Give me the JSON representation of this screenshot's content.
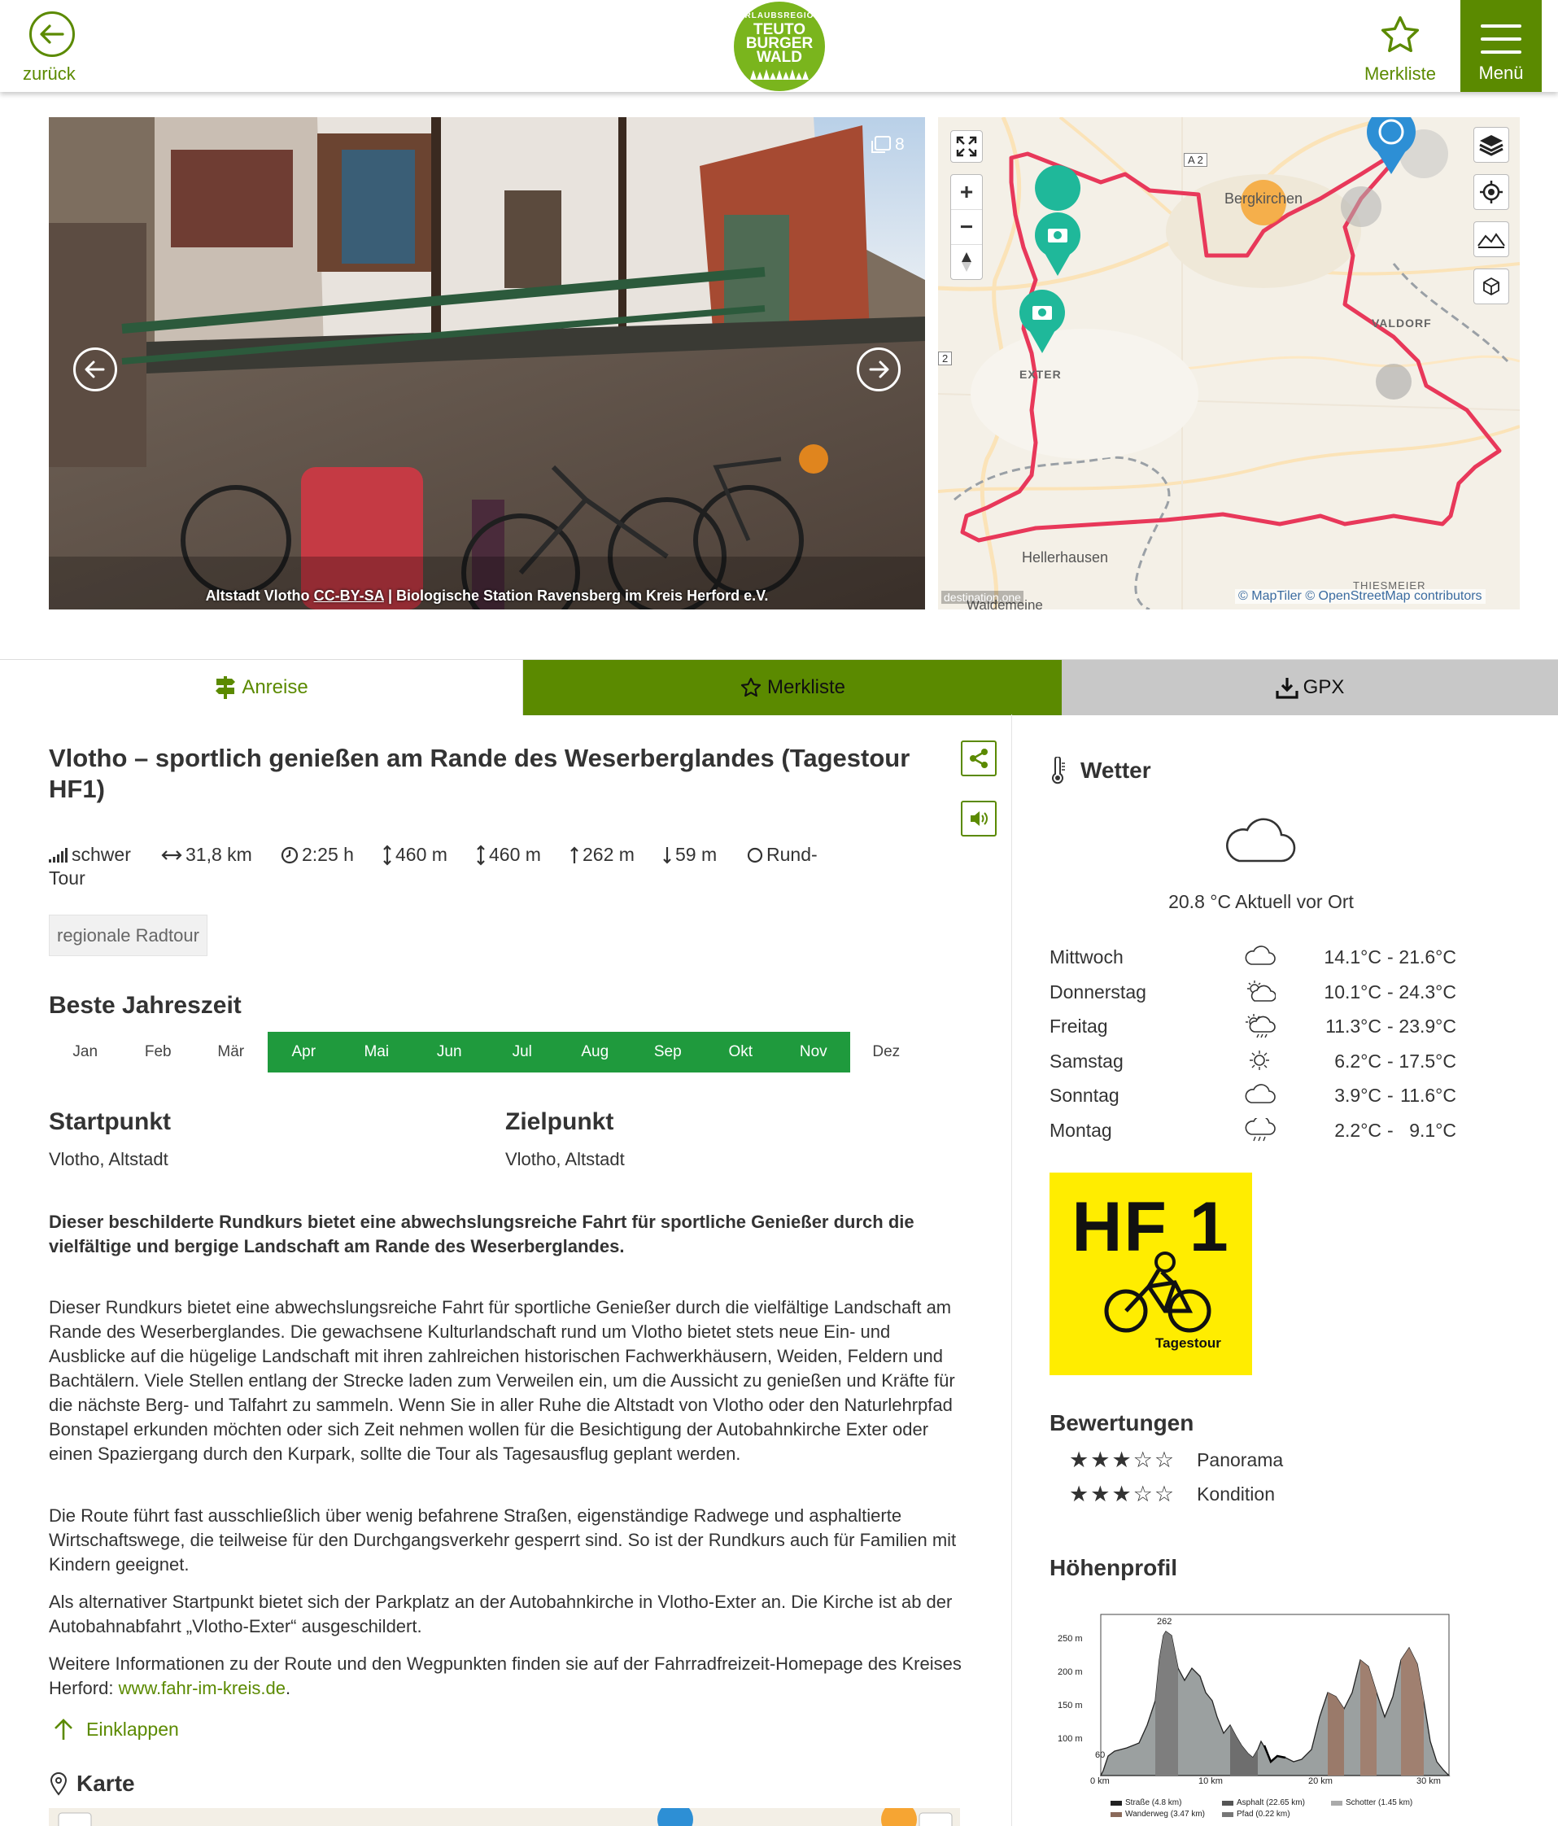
{
  "header": {
    "back_label": "zurück",
    "logo": {
      "line1": "URLAUBSREGION",
      "line2": "TEUTO",
      "line3": "BURGER",
      "line4": "WALD"
    },
    "favorites_label": "Merkliste",
    "menu_label": "Menü"
  },
  "gallery": {
    "image_count": "8",
    "caption_title": "Altstadt Vlotho",
    "caption_license": "CC-BY-SA",
    "caption_author": "| Biologische Station Ravensberg im Kreis Herford e.V."
  },
  "map": {
    "labels": {
      "a2_top": "A 2",
      "a2_left": "2",
      "bergkirchen": "Bergkirchen",
      "valdorf": "VALDORF",
      "exter": "EXTER",
      "hellerhausen": "Hellerhausen",
      "thiesmeier": "THIESMEIER",
      "waldemeine": "Waldemeine",
      "brand": "destination.one"
    },
    "attribution": "© MapTiler © OpenStreetMap contributors",
    "zoom_in": "+",
    "zoom_out": "−"
  },
  "tabs": {
    "travel": "Anreise",
    "favorites": "Merkliste",
    "gpx": "GPX"
  },
  "tour": {
    "title": "Vlotho – sportlich genießen am Rande des Weserberglandes (Tagestour HF1)",
    "stats": {
      "difficulty": "schwer",
      "distance": "31,8 km",
      "duration": "2:25 h",
      "ascent": "460 m",
      "descent": "460 m",
      "max_alt": "262 m",
      "min_alt": "59 m",
      "type_line1": "Rund-",
      "type_line2": "Tour"
    },
    "tag": "regionale Radtour",
    "best_season_title": "Beste Jahreszeit",
    "months": [
      {
        "label": "Jan",
        "active": false
      },
      {
        "label": "Feb",
        "active": false
      },
      {
        "label": "Mär",
        "active": false
      },
      {
        "label": "Apr",
        "active": true
      },
      {
        "label": "Mai",
        "active": true
      },
      {
        "label": "Jun",
        "active": true
      },
      {
        "label": "Jul",
        "active": true
      },
      {
        "label": "Aug",
        "active": true
      },
      {
        "label": "Sep",
        "active": true
      },
      {
        "label": "Okt",
        "active": true
      },
      {
        "label": "Nov",
        "active": true
      },
      {
        "label": "Dez",
        "active": false
      }
    ],
    "start_title": "Startpunkt",
    "start_value": "Vlotho, Altstadt",
    "end_title": "Zielpunkt",
    "end_value": "Vlotho, Altstadt",
    "lead": "Dieser beschilderte Rundkurs bietet eine abwechslungsreiche Fahrt für sportliche Genießer durch die vielfältige und bergige Landschaft am Rande des Weserberglandes.",
    "para1": "Dieser Rundkurs bietet eine abwechslungsreiche Fahrt für sportliche Genießer durch die vielfältige Landschaft am Rande des Weserberglandes. Die gewachsene Kulturlandschaft rund um Vlotho bietet stets neue Ein- und Ausblicke auf die hügelige Landschaft mit ihren zahlreichen historischen Fachwerkhäusern, Weiden, Feldern und Bachtälern. Viele Stellen entlang der Strecke laden zum Verweilen ein, um die Aussicht zu genießen und Kräfte für die nächste Berg- und Talfahrt zu sammeln. Wenn Sie in aller Ruhe die Altstadt von Vlotho oder den Naturlehrpfad Bonstapel erkunden möchten oder sich Zeit nehmen wollen für die Besichtigung der Autobahnkirche Exter oder einen Spaziergang durch den Kurpark, sollte die Tour als Tagesausflug geplant werden.",
    "para2": "Die Route führt fast ausschließlich über wenig befahrene Straßen, eigenständige Radwege und asphaltierte Wirtschaftswege, die teilweise für den Durchgangsverkehr gesperrt sind. So ist der Rundkurs auch für Familien mit Kindern geeignet.",
    "para3": "Als alternativer Startpunkt bietet sich der Parkplatz an der Autobahnkirche in Vlotho-Exter an. Die Kirche ist ab der Autobahnabfahrt „Vlotho-Exter“ ausgeschildert.",
    "para4_text": "Weitere Informationen zu der Route und den Wegpunkten finden sie auf der Fahrradfreizeit-Homepage des Kreises Herford: ",
    "para4_link": "www.fahr-im-kreis.de",
    "para4_end": ".",
    "collapse_label": "Einklappen",
    "map_title": "Karte"
  },
  "weather": {
    "title": "Wetter",
    "current": "20.8 °C Aktuell vor Ort",
    "days": [
      {
        "day": "Mittwoch",
        "icon": "cloud-icon",
        "min": "14.1°C",
        "max": "21.6°C"
      },
      {
        "day": "Donnerstag",
        "icon": "sun-cloud-icon",
        "min": "10.1°C",
        "max": "24.3°C"
      },
      {
        "day": "Freitag",
        "icon": "sun-rain-icon",
        "min": "11.3°C",
        "max": "23.9°C"
      },
      {
        "day": "Samstag",
        "icon": "sun-icon",
        "min": "6.2°C",
        "max": "17.5°C"
      },
      {
        "day": "Sonntag",
        "icon": "cloud-icon",
        "min": "3.9°C",
        "max": "11.6°C"
      },
      {
        "day": "Montag",
        "icon": "rain-icon",
        "min": "2.2°C",
        "max": "9.1°C"
      }
    ],
    "separator": "-"
  },
  "sign": {
    "code": "HF 1",
    "label": "Tagestour"
  },
  "ratings": {
    "title": "Bewertungen",
    "items": [
      {
        "label": "Panorama",
        "stars": 3,
        "max": 5
      },
      {
        "label": "Kondition",
        "stars": 3,
        "max": 5
      }
    ]
  },
  "elevation": {
    "title": "Höhenprofil",
    "y_ticks": [
      "250 m",
      "200 m",
      "150 m",
      "100 m"
    ],
    "x_ticks": [
      "0 km",
      "10 km",
      "20 km",
      "30 km"
    ],
    "peak_label": "262",
    "min_label": "60",
    "legend": [
      "Straße (4.8 km)",
      "Asphalt (22.65 km)",
      "Schotter (1.45 km)",
      "Wanderweg (3.47 km)",
      "Pfad (0.22 km)"
    ]
  },
  "colors": {
    "brand_green": "#5b8a00",
    "month_green": "#1f9a3d",
    "route_red": "#e8385a",
    "sign_yellow": "#ffed00",
    "gpx_gray": "#c8c8c8"
  }
}
